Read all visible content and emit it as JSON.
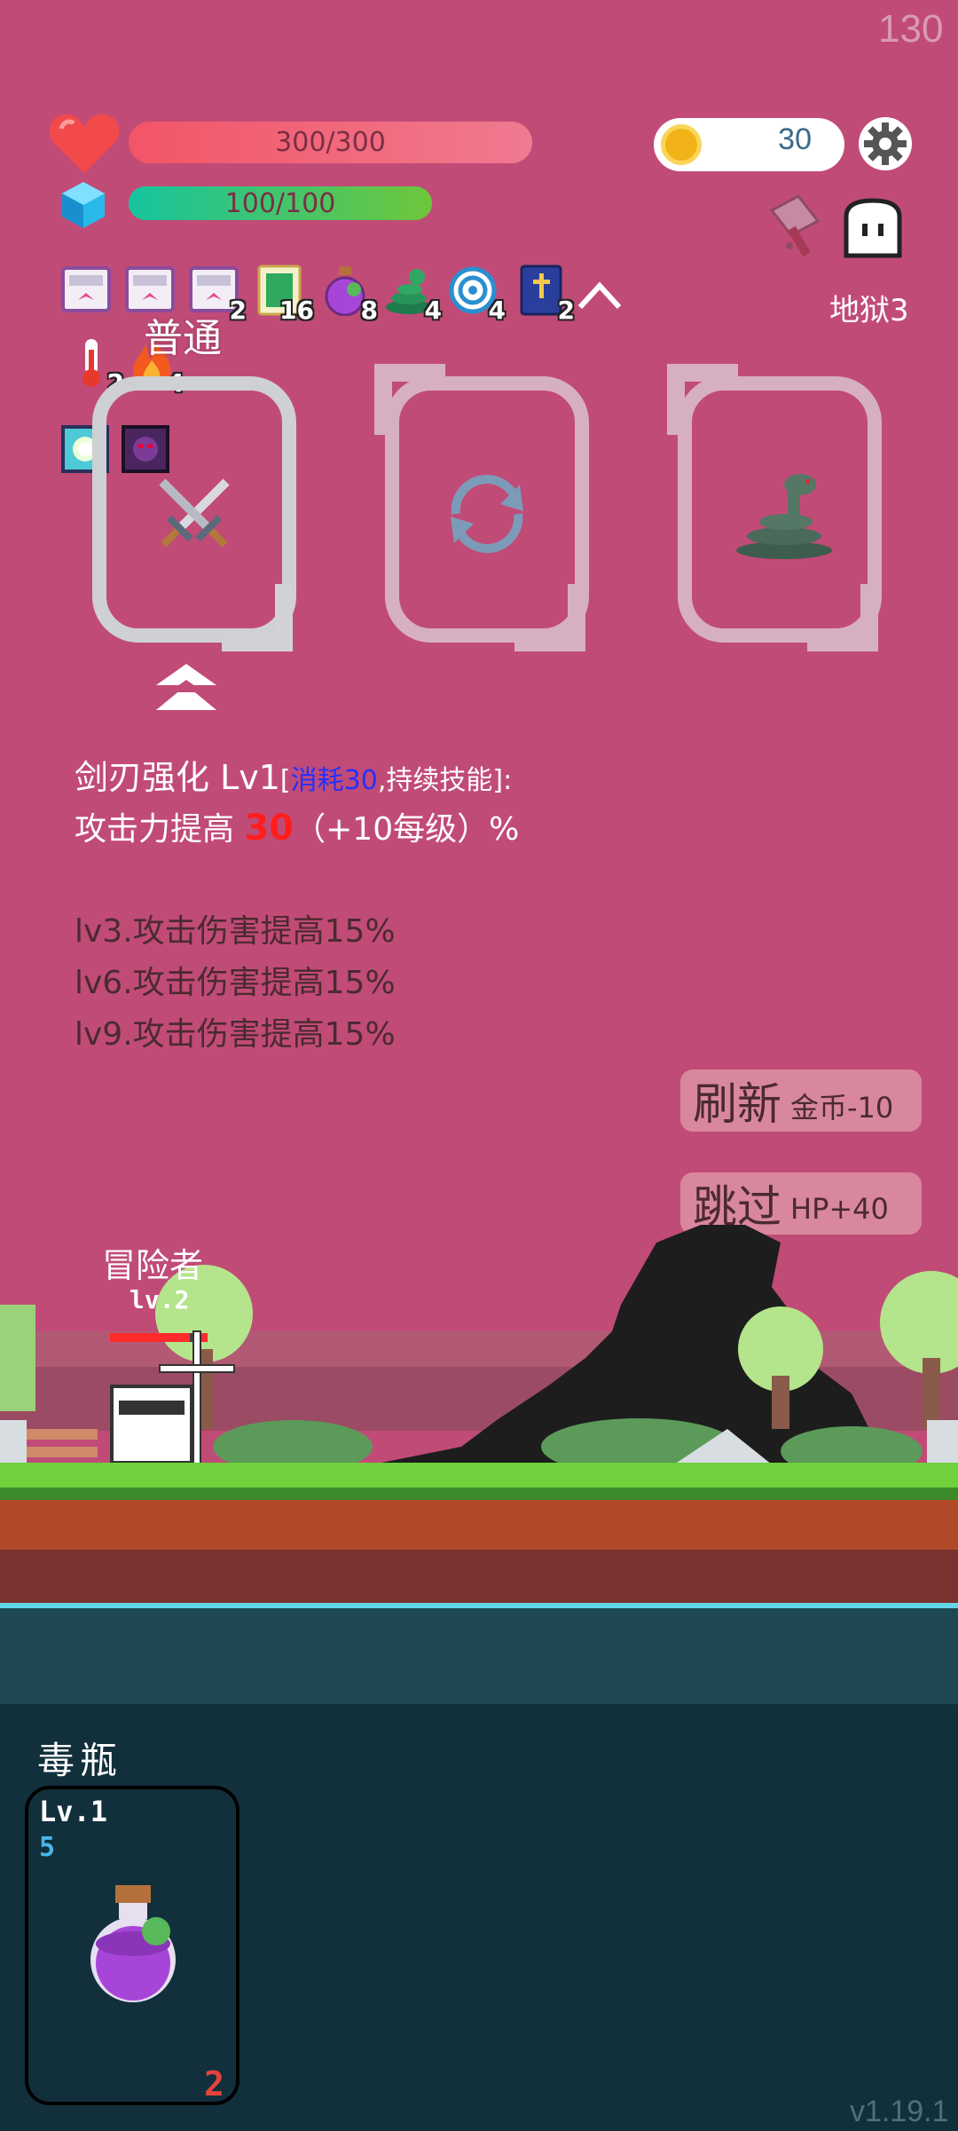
{
  "hud": {
    "fps": "130",
    "hp_text": "300/300",
    "hp_fraction": 1.0,
    "mp_text": "100/100",
    "mp_fraction": 1.0,
    "coins": "30",
    "floor_label": "地狱3"
  },
  "inventory": [
    {
      "icon": "ribbon-card-icon",
      "count": ""
    },
    {
      "icon": "ribbon-card-icon",
      "count": ""
    },
    {
      "icon": "ribbon-card-icon",
      "count": "2"
    },
    {
      "icon": "green-book-icon",
      "count": "16"
    },
    {
      "icon": "purple-potion-icon",
      "count": "8"
    },
    {
      "icon": "green-snake-icon",
      "count": "4"
    },
    {
      "icon": "target-icon",
      "count": "4"
    },
    {
      "icon": "blue-bible-icon",
      "count": "2"
    }
  ],
  "status_effects": [
    {
      "icon": "thermometer-icon",
      "count": "2"
    },
    {
      "icon": "fire-icon",
      "count": "4"
    }
  ],
  "buffs": [
    {
      "icon": "light-buff-icon"
    },
    {
      "icon": "dark-buff-icon"
    }
  ],
  "cards": {
    "label": "普通",
    "slots": [
      {
        "icon": "crossed-swords-icon",
        "selected": true
      },
      {
        "icon": "refresh-cycle-icon",
        "selected": false
      },
      {
        "icon": "coiled-snake-icon",
        "selected": false
      }
    ]
  },
  "skill": {
    "name": "剑刃强化 Lv1",
    "bracket_open": "[",
    "cost": "消耗30",
    "sustain": ",持续技能]:",
    "effect_prefix": "攻击力提高 ",
    "effect_value": "30",
    "effect_suffix": "（+10每级）%",
    "levels": [
      "lv3.攻击伤害提高15%",
      "lv6.攻击伤害提高15%",
      "lv9.攻击伤害提高15%"
    ]
  },
  "buttons": {
    "refresh_label": "刷新",
    "refresh_cost": "金币-10",
    "skip_label": "跳过",
    "skip_gain": "HP+40"
  },
  "hero": {
    "name": "冒险者",
    "level": "lv.2"
  },
  "item": {
    "title": "毒瓶",
    "level": "Lv.1",
    "value": "5",
    "count": "2"
  },
  "version": "v1.19.1",
  "colors": {
    "background": "#c14b77",
    "hp_bar": "#f25567",
    "mp_bar": "#16c49f",
    "highlight_red": "#ff1e1e",
    "cost_blue": "#2430ff",
    "bottom_panel": "#12303c"
  }
}
